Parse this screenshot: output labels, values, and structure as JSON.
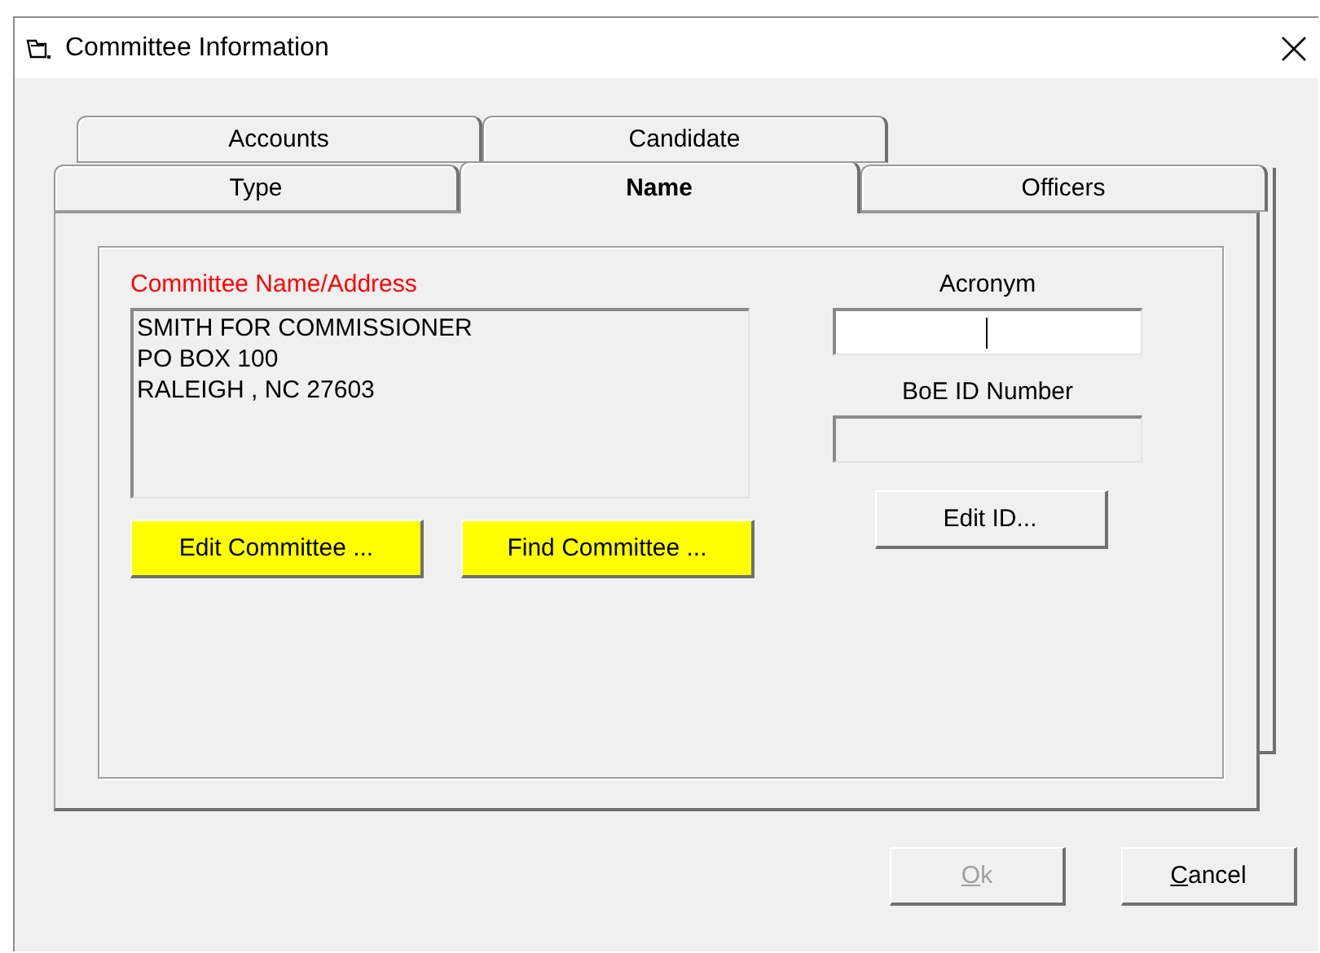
{
  "window": {
    "title": "Committee Information"
  },
  "tabs_back": [
    {
      "label": "Accounts",
      "selected": false
    },
    {
      "label": "Candidate",
      "selected": false
    }
  ],
  "tabs_front": [
    {
      "label": "Type",
      "selected": false
    },
    {
      "label": "Name",
      "selected": true
    },
    {
      "label": "Officers",
      "selected": false
    }
  ],
  "name_tab": {
    "group_label": "Committee Name/Address",
    "address_lines": [
      "SMITH FOR COMMISSIONER",
      "PO BOX 100",
      "RALEIGH , NC 27603"
    ],
    "buttons": [
      {
        "label": "Edit Committee ..."
      },
      {
        "label": "Find Committee ..."
      }
    ],
    "acronym": {
      "label": "Acronym",
      "focused": true,
      "disabled": false
    },
    "boe_id": {
      "label": "BoE ID Number",
      "focused": false,
      "disabled": true
    },
    "edit_id_button": {
      "label": "Edit ID..."
    }
  },
  "footer_buttons": [
    {
      "label": "Ok",
      "disabled": true
    },
    {
      "label": "Cancel",
      "disabled": false
    }
  ]
}
